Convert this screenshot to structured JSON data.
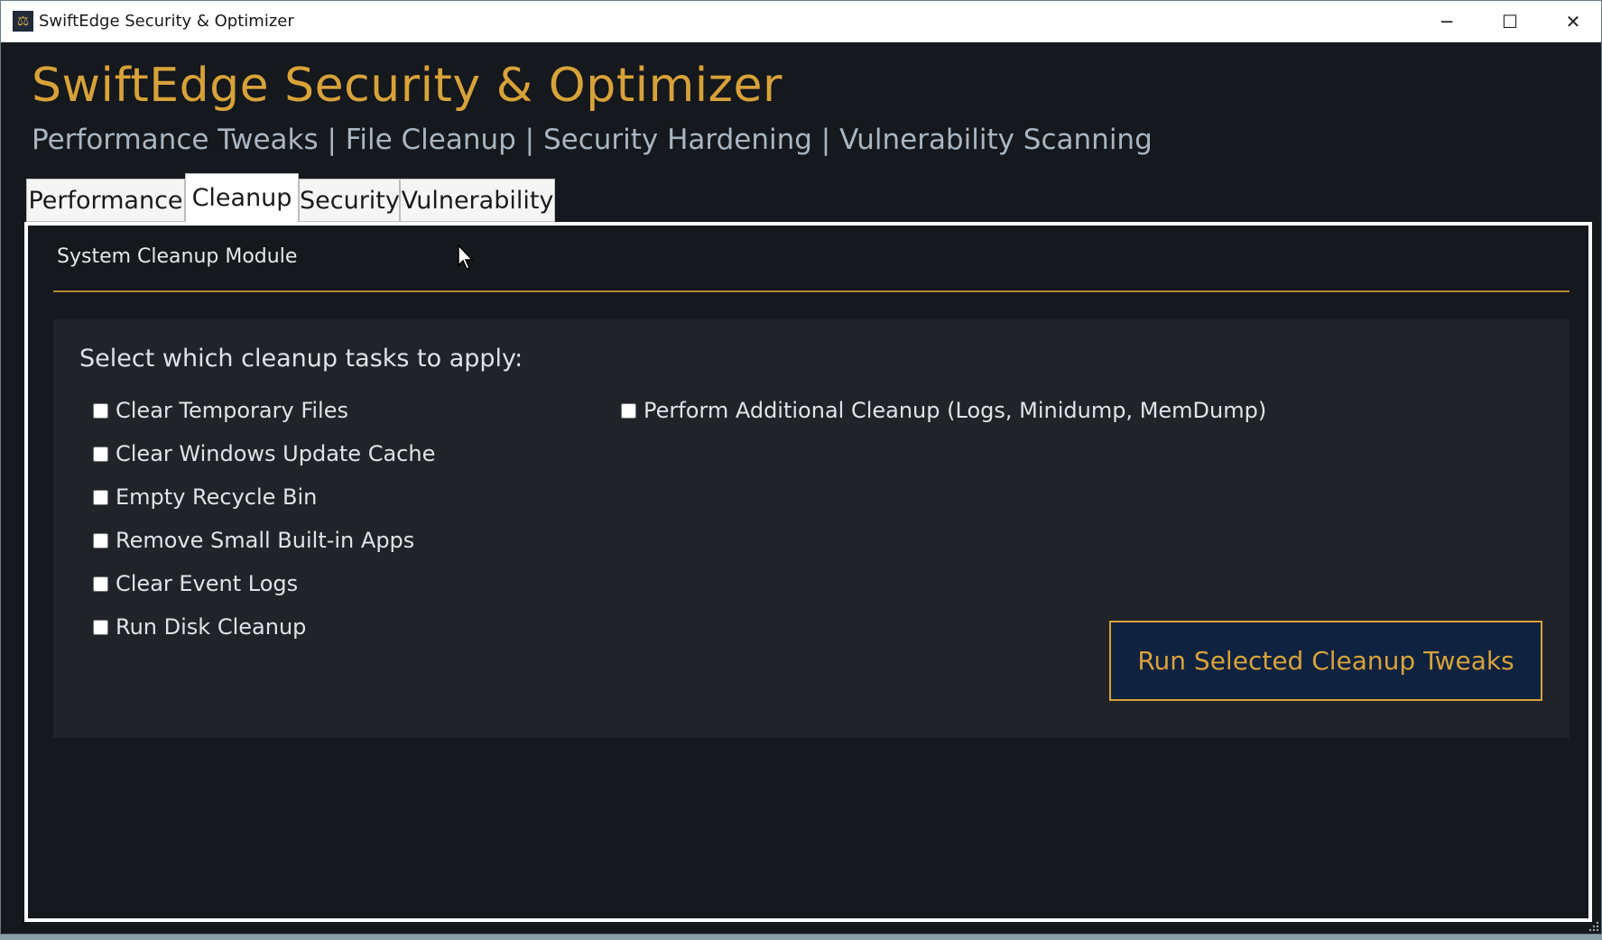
{
  "window": {
    "title": "SwiftEdge Security & Optimizer",
    "app_icon": "shield-icon",
    "controls": {
      "minimize": "─",
      "maximize": "☐",
      "close": "✕"
    }
  },
  "header": {
    "title": "SwiftEdge Security & Optimizer",
    "subtitle": "Performance Tweaks | File Cleanup | Security Hardening | Vulnerability Scanning"
  },
  "tabs": [
    {
      "label": "Performance",
      "active": false
    },
    {
      "label": "Cleanup",
      "active": true
    },
    {
      "label": "Security",
      "active": false
    },
    {
      "label": "Vulnerability",
      "active": false
    }
  ],
  "cleanup": {
    "module_title": "System Cleanup Module",
    "heading": "Select which cleanup tasks to apply:",
    "tasks_left": [
      {
        "label": "Clear Temporary Files",
        "checked": false
      },
      {
        "label": "Clear Windows Update Cache",
        "checked": false
      },
      {
        "label": "Empty Recycle Bin",
        "checked": false
      },
      {
        "label": "Remove Small Built-in Apps",
        "checked": false
      },
      {
        "label": "Clear Event Logs",
        "checked": false
      },
      {
        "label": "Run Disk Cleanup",
        "checked": false
      }
    ],
    "tasks_right": [
      {
        "label": "Perform Additional Cleanup (Logs, Minidump, MemDump)",
        "checked": false
      }
    ],
    "run_button": "Run Selected Cleanup Tweaks"
  },
  "colors": {
    "accent": "#d8a23a",
    "background": "#15181c",
    "card": "#202328",
    "button_bg": "#0f2240"
  }
}
